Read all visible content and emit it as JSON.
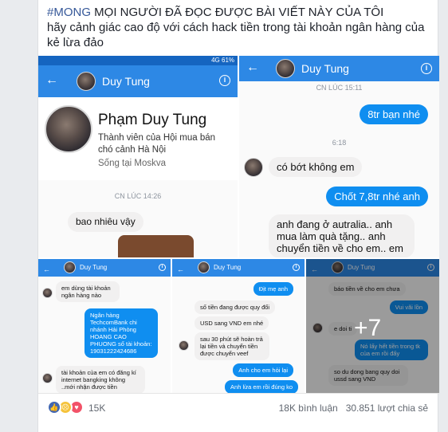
{
  "post": {
    "hashtag": "#MONG",
    "caption_line1": " MỌI NGƯỜI ĐÃ ĐỌC ĐƯỢC BÀI VIẾT NÀY CỦA TÔI",
    "caption_line2": "hãy cảnh giác cao độ với cách hack tiền trong tài khoản ngân hàng của kẻ lừa đảo"
  },
  "photo1": {
    "status": "4G 61%",
    "contact": "Duy Tung",
    "profile_name": "Phạm Duy Tung",
    "profile_desc": "Thành viên của Hội mua bán chó cảnh Hà Nội",
    "profile_location": "Sống tại Moskva",
    "timestamp": "CN LÚC 14:26",
    "msg1": "bao nhiêu vậy"
  },
  "photo2": {
    "contact": "Duy Tung",
    "timestamp1": "CN LÚC 15:11",
    "msg1": "8tr bạn nhé",
    "timestamp2": "6:18",
    "msg2": "có bớt không em",
    "msg3": "Chốt 7,8tr nhé anh",
    "msg4": "anh đang ở autralia.. anh mua làm quà tặng.. anh chuyển tiền về cho em.. em"
  },
  "photo3": {
    "contact": "Duy Tung",
    "msg1": "em dùng tài khoản ngân hàng nào",
    "msg2": "Ngân hàng TechcomBank chi nhánh Hải Phòng HOANG CAO PHUONG số tài khoản: 19031222424686",
    "msg3": "tài khoản của em có đăng kí internet bangking không ..mới nhận được tiền"
  },
  "photo4": {
    "contact": "Duy Tung",
    "msg1": "Địt mẹ anh",
    "msg2": "số tiền đang được quy đổi",
    "msg3": "USD sang VND em nhé",
    "msg4": "sau 30 phút sẽ hoàn trả lại tiền và chuyển tiền được chuyển veef",
    "msg5": "Anh cho em hỏi lại",
    "msg6": "Anh lừa em rồi đúng ko"
  },
  "photo5": {
    "contact": "Duy Tung",
    "msg1": "báo tiền về cho em chưa",
    "msg2": "Vui vãi lồn",
    "msg3": "e doi ti",
    "msg4": "Nó lấy hết tiền trong tk của em rồi đấy",
    "msg5": "so du dong bang quy doi ussd sang VND",
    "more": "+7"
  },
  "footer": {
    "reactions_count": "15K",
    "comments": "18K bình luận",
    "shares": "30.851 lượt chia sẻ"
  },
  "colors": {
    "messenger_blue": "#2d88e5",
    "bubble_blue": "#0f8ef0",
    "like": "#4267b2",
    "sad": "#f5c33b",
    "love": "#f25268"
  }
}
